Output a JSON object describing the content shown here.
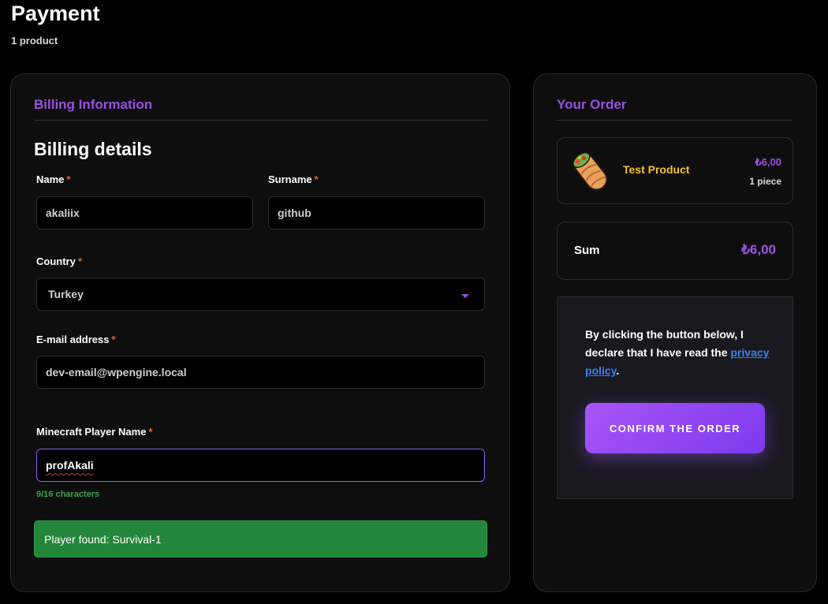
{
  "header": {
    "title": "Payment",
    "subtitle": "1 product"
  },
  "billing": {
    "section_title": "Billing Information",
    "heading": "Billing details",
    "required_marker": "*",
    "fields": {
      "name": {
        "label": "Name",
        "value": "akaliix"
      },
      "surname": {
        "label": "Surname",
        "value": "github"
      },
      "country": {
        "label": "Country",
        "value": "Turkey"
      },
      "email": {
        "label": "E-mail address",
        "value": "dev-email@wpengine.local"
      },
      "player": {
        "label": "Minecraft Player Name",
        "value": "profAkali",
        "counter": "9/16 characters"
      }
    },
    "player_status": "Player found: Survival-1"
  },
  "order": {
    "section_title": "Your Order",
    "product": {
      "name": "Test Product",
      "price": "₺6,00",
      "quantity": "1 piece",
      "icon": "burrito-icon"
    },
    "sum": {
      "label": "Sum",
      "value": "₺6,00"
    },
    "declaration": {
      "text_before": "By clicking the button below, I declare that I have read the ",
      "link_text": "privacy policy",
      "text_after": "."
    },
    "confirm_label": "CONFIRM THE ORDER"
  },
  "colors": {
    "accent": "#9b51e0",
    "product_name": "#f2c230",
    "success": "#23863a",
    "link": "#3b82f6",
    "required": "#e0663a"
  }
}
